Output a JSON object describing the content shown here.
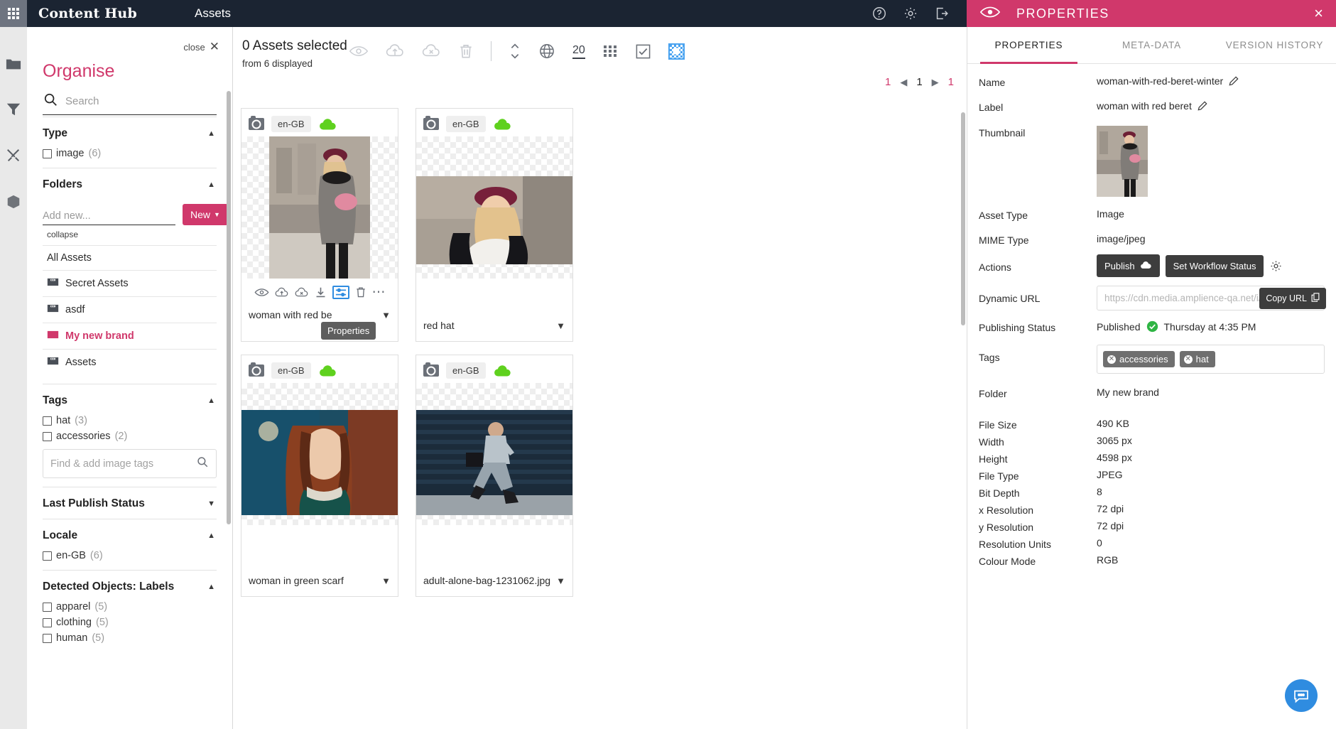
{
  "topbar": {
    "waffle_icon": "apps-grid-icon",
    "brand": "Content Hub",
    "section": "Assets",
    "help_icon": "help-circle-icon",
    "settings_icon": "gear-icon",
    "logout_icon": "logout-icon"
  },
  "properties_header": {
    "eye_icon": "eye-icon",
    "title": "PROPERTIES",
    "close": "×"
  },
  "rail": {
    "items": [
      {
        "icon": "folder-icon",
        "name": "rail-item-folders"
      },
      {
        "icon": "filter-icon",
        "name": "rail-item-filters"
      },
      {
        "icon": "tools-icon",
        "name": "rail-item-tools"
      },
      {
        "icon": "box-icon",
        "name": "rail-item-packages"
      }
    ]
  },
  "organise": {
    "close_label": "close",
    "title": "Organise",
    "search_placeholder": "Search",
    "search_value": "",
    "type_facet": {
      "title": "Type",
      "items": [
        {
          "label": "image",
          "count": "(6)"
        }
      ]
    },
    "folders_facet": {
      "title": "Folders",
      "add_placeholder": "Add new...",
      "add_value": "",
      "new_button": "New",
      "collapse_label": "collapse",
      "all_assets": "All Assets",
      "items": [
        {
          "label": "Secret Assets",
          "active": false
        },
        {
          "label": "asdf",
          "active": false
        },
        {
          "label": "My new brand",
          "active": true
        },
        {
          "label": "Assets",
          "active": false
        }
      ]
    },
    "tags_facet": {
      "title": "Tags",
      "items": [
        {
          "label": "hat",
          "count": "(3)"
        },
        {
          "label": "accessories",
          "count": "(2)"
        }
      ],
      "find_placeholder": "Find & add image tags",
      "find_value": ""
    },
    "last_publish_facet": {
      "title": "Last Publish Status"
    },
    "locale_facet": {
      "title": "Locale",
      "items": [
        {
          "label": "en-GB",
          "count": "(6)"
        }
      ]
    },
    "detected_objects_facet": {
      "title": "Detected Objects: Labels",
      "items": [
        {
          "label": "apparel",
          "count": "(5)"
        },
        {
          "label": "clothing",
          "count": "(5)"
        },
        {
          "label": "human",
          "count": "(5)"
        }
      ]
    }
  },
  "toolbar": {
    "selected_count": "0 Assets selected",
    "displayed_from": "from 6 displayed",
    "icons": [
      {
        "name": "preview-eye-icon"
      },
      {
        "name": "publish-cloud-up-icon"
      },
      {
        "name": "unpublish-cloud-x-icon"
      },
      {
        "name": "delete-trash-icon"
      }
    ],
    "sort_icon": "sort-updown-icon",
    "locale_icon": "globe-icon",
    "page_size": "20",
    "grid_view_icon": "grid-view-icon",
    "select_all_icon": "select-all-checkbox-icon",
    "transparency_icon": "transparency-checker-icon"
  },
  "pager": {
    "first": "1",
    "prev": "◀",
    "current": "1",
    "next": "▶",
    "last": "1"
  },
  "assets": [
    {
      "locale": "en-GB",
      "name": "woman with red be",
      "full_name": "woman with red beret",
      "published": true,
      "hovered": true,
      "tooltip": "Properties",
      "actions": [
        "preview-eye-icon",
        "publish-cloud-up-icon",
        "unpublish-cloud-x-icon",
        "download-icon",
        "properties-icon",
        "delete-trash-icon",
        "more-ellipsis-icon"
      ]
    },
    {
      "locale": "en-GB",
      "name": "red hat",
      "published": true,
      "hovered": false
    },
    {
      "locale": "en-GB",
      "name": "woman in green scarf",
      "published": true,
      "hovered": false
    },
    {
      "locale": "en-GB",
      "name": "adult-alone-bag-1231062.jpg",
      "published": true,
      "hovered": false
    }
  ],
  "props_panel": {
    "tabs": [
      {
        "label": "PROPERTIES",
        "active": true
      },
      {
        "label": "META-DATA",
        "active": false
      },
      {
        "label": "VERSION HISTORY",
        "active": false
      }
    ],
    "fields": {
      "name_label": "Name",
      "name_value": "woman-with-red-beret-winter",
      "label_label": "Label",
      "label_value": "woman with red beret",
      "thumbnail_label": "Thumbnail",
      "asset_type_label": "Asset Type",
      "asset_type_value": "Image",
      "mime_type_label": "MIME Type",
      "mime_type_value": "image/jpeg",
      "actions_label": "Actions",
      "publish_button": "Publish",
      "workflow_button": "Set Workflow Status",
      "dynamic_url_label": "Dynamic URL",
      "dynamic_url_placeholder": "https://cdn.media.amplience-qa.net/i/l",
      "dynamic_url_value": "",
      "copy_url_button": "Copy URL",
      "publishing_status_label": "Publishing Status",
      "publishing_status_value": "Published",
      "publishing_status_date": "Thursday at 4:35 PM",
      "tags_label": "Tags",
      "tags": [
        "accessories",
        "hat"
      ],
      "folder_label": "Folder",
      "folder_value": "My new brand",
      "file_size_label": "File Size",
      "file_size_value": "490 KB",
      "width_label": "Width",
      "width_value": "3065 px",
      "height_label": "Height",
      "height_value": "4598 px",
      "file_type_label": "File Type",
      "file_type_value": "JPEG",
      "bit_depth_label": "Bit Depth",
      "bit_depth_value": "8",
      "x_res_label": "x Resolution",
      "x_res_value": "72 dpi",
      "y_res_label": "y Resolution",
      "y_res_value": "72 dpi",
      "res_units_label": "Resolution Units",
      "res_units_value": "0",
      "colour_mode_label": "Colour Mode",
      "colour_mode_value": "RGB"
    }
  },
  "chat": {
    "icon": "chat-bubble-icon"
  },
  "colors": {
    "accent_pink": "#d0386b",
    "topbar_dark": "#1b2432",
    "publish_green": "#5fd11e",
    "blue": "#2f8ce0"
  }
}
